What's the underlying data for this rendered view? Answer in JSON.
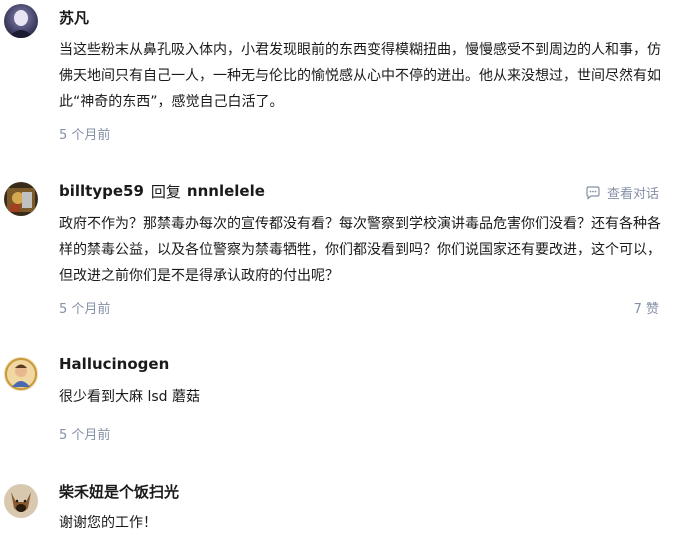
{
  "comments": [
    {
      "author": "苏凡",
      "content": "当这些粉末从鼻孔吸入体内，小君发现眼前的东西变得模糊扭曲，慢慢感受不到周边的人和事，仿佛天地间只有自己一人，一种无与伦比的愉悦感从心中不停的迸出。他从来没想过，世间尽然有如此“神奇的东西”，感觉自己白活了。",
      "time": "5 个月前"
    },
    {
      "author": "billtype59",
      "reply_word": "回复",
      "reply_to": "nnnlelele",
      "view_conversation": "查看对话",
      "content": "政府不作为？那禁毒办每次的宣传都没有看？每次警察到学校演讲毒品危害你们没看？还有各种各样的禁毒公益，以及各位警察为禁毒牺牲，你们都没看到吗？你们说国家还有要改进，这个可以，但改进之前你们是不是得承认政府的付出呢？",
      "time": "5 个月前",
      "likes": "7 赞"
    },
    {
      "author": "Hallucinogen",
      "content": "很少看到大麻 lsd 蘑菇",
      "time": "5 个月前"
    },
    {
      "author": "柴禾妞是个饭扫光",
      "content": "谢谢您的工作！"
    }
  ],
  "colors": {
    "text": "#1a1a1a",
    "meta": "#8590a6"
  },
  "icons": {
    "conversation": "chat-bubble-icon"
  }
}
